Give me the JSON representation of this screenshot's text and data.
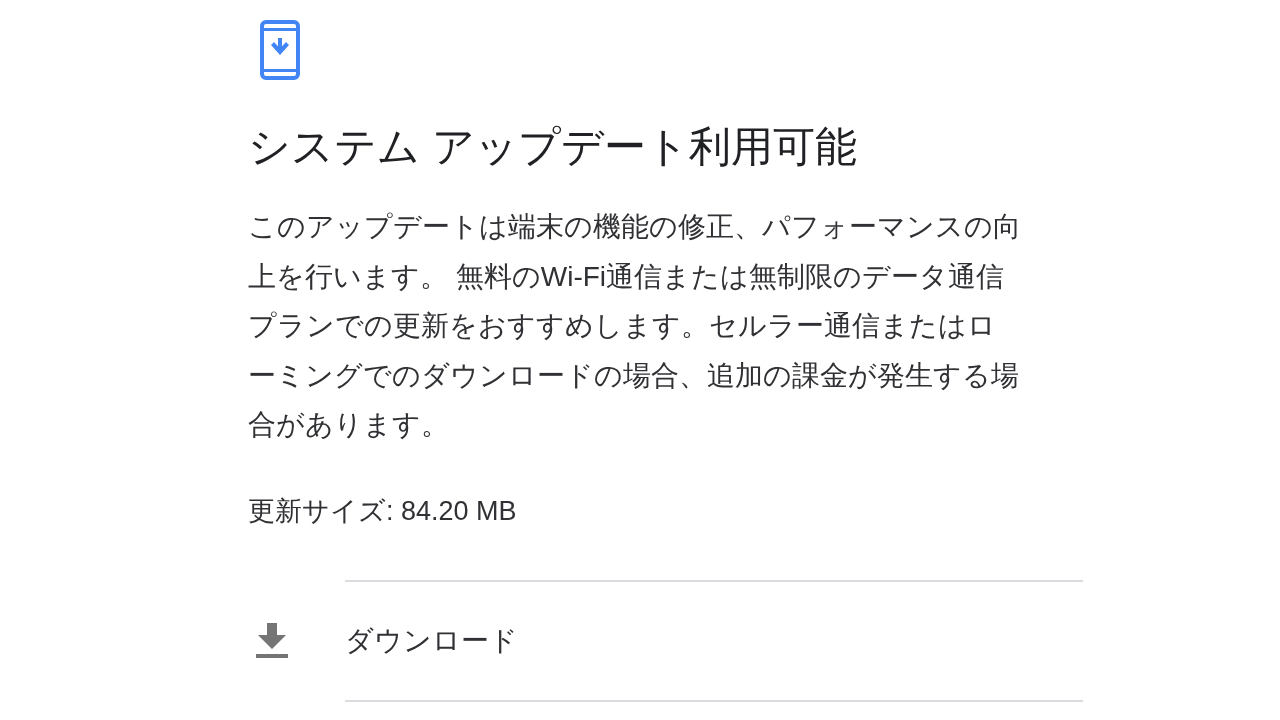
{
  "header": {
    "title": "システム アップデート利用可能"
  },
  "description": "このアップデートは端末の機能の修正、パフォーマンスの向上を行います。 無料のWi-Fi通信または無制限のデータ通信プランでの更新をおすすめします。セルラー通信またはローミングでのダウンロードの場合、追加の課金が発生する場合があります。",
  "update_size": "更新サイズ: 84.20 MB",
  "actions": [
    {
      "kind": "download",
      "label": "ダウンロード"
    }
  ]
}
